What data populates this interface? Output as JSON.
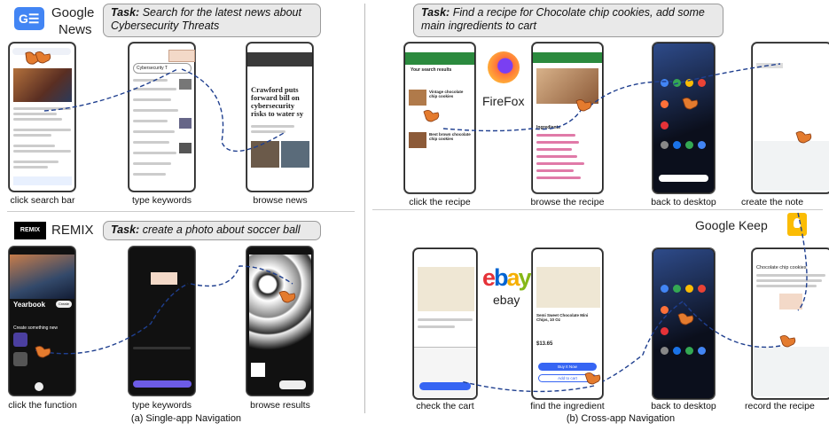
{
  "panel_a": {
    "caption": "(a) Single-app Navigation",
    "google_news": {
      "app_name_line1": "Google",
      "app_name_line2": "News",
      "task_label": "Task:",
      "task_text": "Search for the latest news about Cybersecurity Threats",
      "steps": [
        "click search bar",
        "type keywords",
        "browse news"
      ],
      "headline": "Crawford puts forward bill on cybersecurity risks to water sy",
      "search_query": "Cybersecurity T"
    },
    "remix": {
      "app_name": "REMIX",
      "logo_text": "REMIX",
      "task_label": "Task:",
      "task_text": "create a photo about soccer ball",
      "steps": [
        "click the function",
        "type keywords",
        "browse results"
      ],
      "screen_title": "Yearbook",
      "section": "Create something new",
      "create_btn": "Create"
    }
  },
  "panel_b": {
    "caption": "(b) Cross-app Navigation",
    "task_label": "Task:",
    "task_text": "Find a recipe for Chocolate chip cookies, add some main ingredients to cart",
    "firefox": {
      "app_name": "FireFox",
      "steps": [
        "click the recipe",
        "browse the recipe",
        "back to desktop"
      ],
      "page_header": "Your search results",
      "recipe1": "Vintage chocolate chip cookies",
      "recipe2": "Best brown chocolate chip cookies",
      "ingredients_label": "Ingredients"
    },
    "google_keep": {
      "app_name": "Google Keep",
      "steps": [
        "create the note",
        "record the recipe"
      ],
      "note_title": "Chocolate chip cookies"
    },
    "ebay": {
      "app_name": "ebay",
      "logo_letters": [
        "e",
        "b",
        "a",
        "y"
      ],
      "steps": [
        "check the cart",
        "find the ingredient",
        "back to desktop"
      ],
      "product": "Semi Sweet Chocolate Mini Chips, 10 Oz",
      "price": "$13.65",
      "buy_label": "Buy It Now",
      "cart_label": "Add to cart"
    },
    "colors": {
      "ebay_e": "#e53238",
      "ebay_b": "#0064d2",
      "ebay_a": "#f5af02",
      "ebay_y": "#86b817",
      "firefox": "#ff7139",
      "keep": "#fbbc04",
      "arrow": "#1f3f8f"
    }
  }
}
